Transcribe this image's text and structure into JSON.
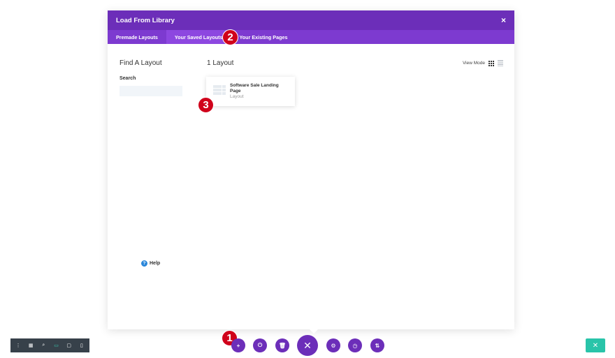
{
  "modal": {
    "title": "Load From Library",
    "close_glyph": "×",
    "tabs": [
      {
        "label": "Premade Layouts",
        "active": false
      },
      {
        "label": "Your Saved Layouts",
        "active": true
      },
      {
        "label": "Your Existing Pages",
        "active": false
      }
    ]
  },
  "sidebar": {
    "title": "Find A Layout",
    "search_label": "Search",
    "search_value": "",
    "help_glyph": "?",
    "help_label": "Help"
  },
  "results": {
    "count_label": "1 Layout",
    "view_mode_label": "View Mode",
    "items": [
      {
        "title": "Software Sale Landing Page",
        "type": "Layout"
      }
    ]
  },
  "callouts": [
    "1",
    "2",
    "3"
  ],
  "bottom_left_bar": {
    "icons": [
      "more-icon",
      "wireframe-icon",
      "zoom-icon",
      "desktop-icon",
      "tablet-icon",
      "phone-icon"
    ],
    "glyphs": [
      "⋮",
      "▦",
      "⌕",
      "▭",
      "▢",
      "▯"
    ]
  },
  "bottom_center": {
    "glyphs": [
      "+",
      "⏻",
      "🗑",
      "✕",
      "⚙",
      "◷",
      "⇅"
    ]
  },
  "teal_button": {
    "glyph": "✕"
  },
  "colors": {
    "brand_purple": "#6c2eb9",
    "tab_bar": "#7d3ad0",
    "callout_red": "#d0021b",
    "teal": "#29c4a9",
    "dark_bar": "#37414a"
  }
}
